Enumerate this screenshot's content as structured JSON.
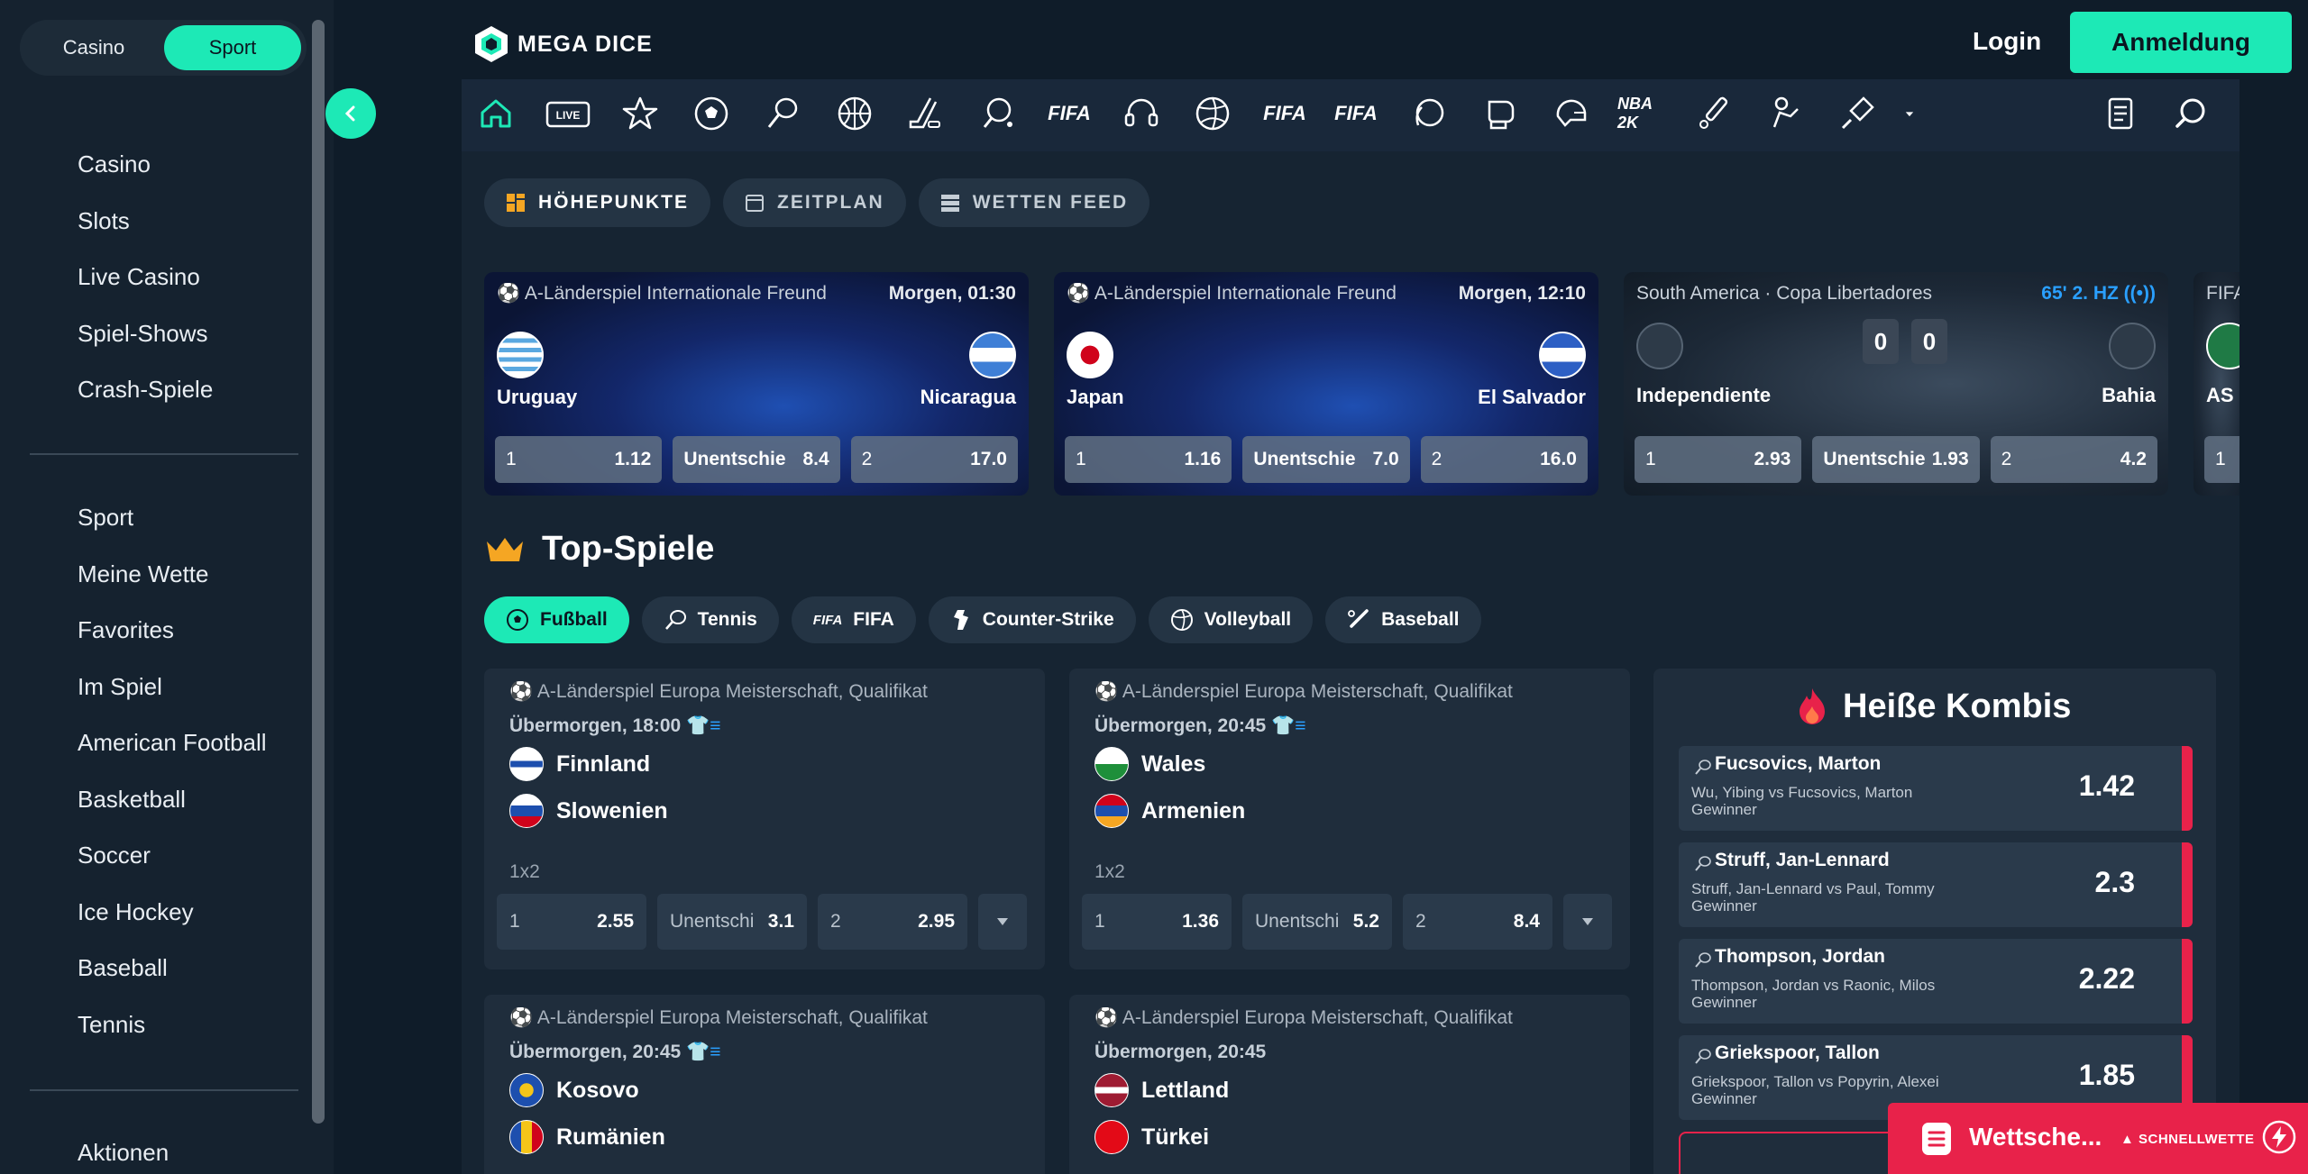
{
  "sidebar": {
    "toggle": {
      "casino": "Casino",
      "sport": "Sport"
    },
    "casino_items": [
      "Casino",
      "Slots",
      "Live Casino",
      "Spiel-Shows",
      "Crash-Spiele"
    ],
    "sport_items": [
      "Sport",
      "Meine Wette",
      "Favorites",
      "Im Spiel",
      "American Football",
      "Basketball",
      "Soccer",
      "Ice Hockey",
      "Baseball",
      "Tennis"
    ],
    "promo_items": [
      "Aktionen"
    ]
  },
  "header": {
    "logo_text": "MEGA DICE",
    "login": "Login",
    "signup": "Anmeldung"
  },
  "sport_icons": [
    "home-icon",
    "live-icon",
    "favorites-star-icon",
    "soccer-icon",
    "tennis-icon",
    "basketball-icon",
    "ice-hockey-icon",
    "table-tennis-icon",
    "fifa-icon",
    "esports-headset-icon",
    "volleyball-icon",
    "fifa-volta-icon",
    "fifa-penalty-icon",
    "handball-icon",
    "boxing-icon",
    "american-football-icon",
    "nba-2k-icon",
    "cricket-icon",
    "kabaddi-icon",
    "badminton-icon",
    "more-dropdown-icon",
    "betslip-history-icon",
    "search-icon"
  ],
  "sport_icon_labels": {
    "live": "LIVE",
    "fifa": "FIFA",
    "nba": "NBA 2K"
  },
  "tabs": [
    {
      "label": "HÖHEPUNKTE",
      "icon": "highlights-icon"
    },
    {
      "label": "ZEITPLAN",
      "icon": "calendar-icon"
    },
    {
      "label": "WETTEN FEED",
      "icon": "feed-icon"
    }
  ],
  "featured": [
    {
      "league": "A-Länderspiel Internationale Freund",
      "time": "Morgen, 01:30",
      "home": "Uruguay",
      "away": "Nicaragua",
      "odds": [
        {
          "k": "1",
          "v": "1.12"
        },
        {
          "k": "Unentschie",
          "v": "8.4"
        },
        {
          "k": "2",
          "v": "17.0"
        }
      ]
    },
    {
      "league": "A-Länderspiel Internationale Freund",
      "time": "Morgen, 12:10",
      "home": "Japan",
      "away": "El Salvador",
      "odds": [
        {
          "k": "1",
          "v": "1.16"
        },
        {
          "k": "Unentschie",
          "v": "7.0"
        },
        {
          "k": "2",
          "v": "16.0"
        }
      ]
    },
    {
      "league": "South America · Copa Libertadores",
      "time": "65' 2. HZ",
      "home": "Independiente",
      "away": "Bahia",
      "score_home": "0",
      "score_away": "0",
      "odds": [
        {
          "k": "1",
          "v": "2.93"
        },
        {
          "k": "Unentschie",
          "v": "1.93"
        },
        {
          "k": "2",
          "v": "4.2"
        }
      ]
    },
    {
      "league": "FIFA F",
      "home": "AS S",
      "odds": [
        {
          "k": "1",
          "v": ""
        }
      ]
    }
  ],
  "top_games": {
    "title": "Top-Spiele",
    "sports": [
      "Fußball",
      "Tennis",
      "FIFA",
      "Counter-Strike",
      "Volleyball",
      "Baseball"
    ],
    "games": [
      {
        "league": "A-Länderspiel Europa Meisterschaft, Qualifikat",
        "when": "Übermorgen, 18:00",
        "home": "Finnland",
        "away": "Slowenien",
        "market": "1x2",
        "odds": [
          {
            "k": "1",
            "v": "2.55"
          },
          {
            "k": "Unentschi",
            "v": "3.1"
          },
          {
            "k": "2",
            "v": "2.95"
          }
        ]
      },
      {
        "league": "A-Länderspiel Europa Meisterschaft, Qualifikat",
        "when": "Übermorgen, 20:45",
        "home": "Wales",
        "away": "Armenien",
        "market": "1x2",
        "odds": [
          {
            "k": "1",
            "v": "1.36"
          },
          {
            "k": "Unentschi",
            "v": "5.2"
          },
          {
            "k": "2",
            "v": "8.4"
          }
        ]
      },
      {
        "league": "A-Länderspiel Europa Meisterschaft, Qualifikat",
        "when": "Übermorgen, 20:45",
        "home": "Kosovo",
        "away": "Rumänien"
      },
      {
        "league": "A-Länderspiel Europa Meisterschaft, Qualifikat",
        "when": "Übermorgen, 20:45",
        "home": "Lettland",
        "away": "Türkei"
      }
    ]
  },
  "kombis": {
    "title": "Heiße Kombis",
    "items": [
      {
        "player": "Fucsovics, Marton",
        "match": "Wu, Yibing vs Fucsovics, Marton",
        "market": "Gewinner",
        "value": "1.42"
      },
      {
        "player": "Struff, Jan-Lennard",
        "match": "Struff, Jan-Lennard vs Paul, Tommy",
        "market": "Gewinner",
        "value": "2.3"
      },
      {
        "player": "Thompson, Jordan",
        "match": "Thompson, Jordan vs Raonic, Milos",
        "market": "Gewinner",
        "value": "2.22"
      },
      {
        "player": "Griekspoor, Tallon",
        "match": "Griekspoor, Tallon vs Popyrin, Alexei",
        "market": "Gewinner",
        "value": "1.85"
      }
    ]
  },
  "betslip": {
    "label": "Wettsche...",
    "quick": "SCHNELLWETTE"
  },
  "colors": {
    "accent": "#1de9b6",
    "background": "#0f1c29",
    "panel": "#162432",
    "card": "#1f2d3c",
    "hot": "#e8224a",
    "live": "#2aa0ff"
  }
}
